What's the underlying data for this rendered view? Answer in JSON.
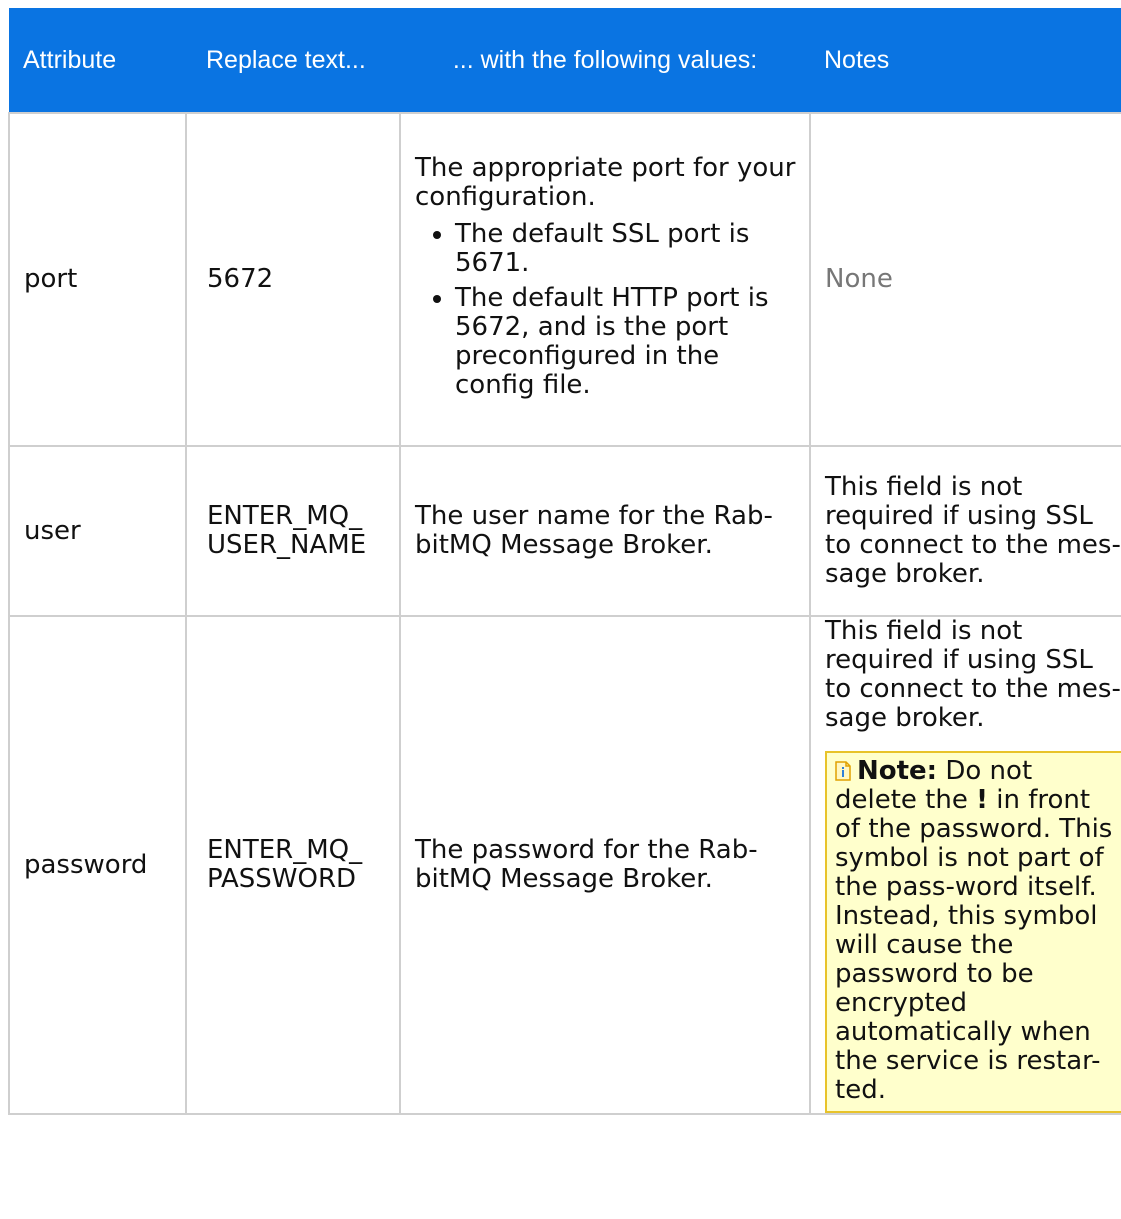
{
  "table": {
    "headers": [
      "Attribute",
      "Replace text...",
      "... with the following values:",
      "Notes"
    ],
    "rows": [
      {
        "attribute": "port",
        "replace": "5672",
        "value_text": "The appropriate port for your configuration.",
        "value_bullets": [
          "The default SSL port is 5671.",
          "The default HTTP port is 5672, and is the port preconfigured in the config file."
        ],
        "notes": "None"
      },
      {
        "attribute": "user",
        "replace": "ENTER_MQ_ USER_NAME",
        "value_text": "The user name for the Rab-bitMQ Message Broker.",
        "notes": "This field is not required if using SSL to connect to the mes-sage broker."
      },
      {
        "attribute": "password",
        "replace": "ENTER_MQ_ PASSWORD",
        "value_text": "The password for the Rab-bitMQ Message Broker.",
        "notes": "This field is not required if using SSL to connect to the mes-sage broker.",
        "note_box": {
          "icon": "note-info-icon",
          "label": "Note:",
          "text_before": "Do not delete the",
          "symbol": "!",
          "text_after": "in front of the password. This symbol is not part of the pass-word itself. Instead, this symbol will cause the password to be encrypted automatically when the service is restar-ted."
        }
      }
    ]
  },
  "colors": {
    "header_bg": "#0a74e2",
    "header_text": "#ffffff",
    "note_bg": "#ffffcc",
    "note_border": "#e8c32a"
  }
}
